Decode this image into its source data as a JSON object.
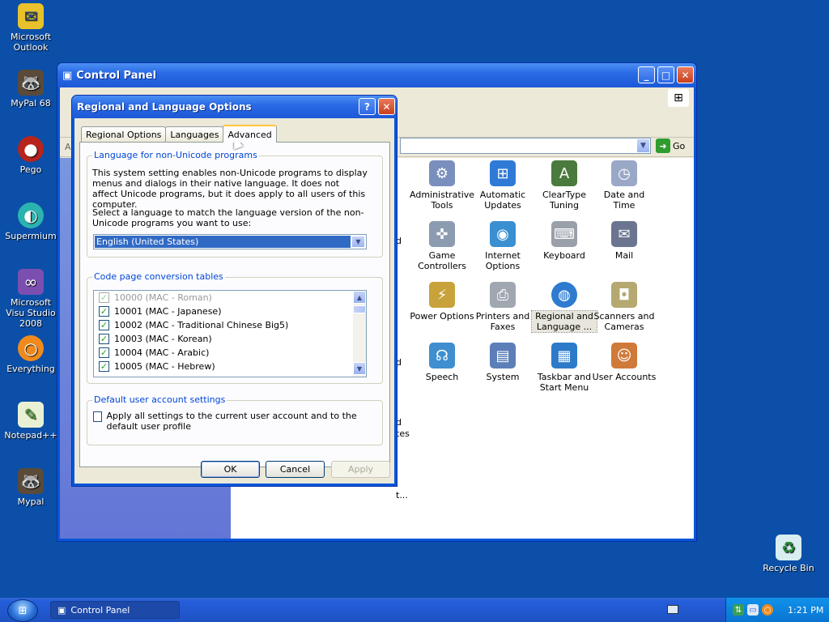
{
  "desktop": {
    "icons": [
      {
        "label": "Microsoft Outlook",
        "icon": "outlook-icon"
      },
      {
        "label": "MyPal 68",
        "icon": "mypal-icon"
      },
      {
        "label": "Pego",
        "icon": "pego-icon"
      },
      {
        "label": "Supermium",
        "icon": "supermium-icon"
      },
      {
        "label": "Microsoft Visu Studio 2008",
        "icon": "visual-studio-icon"
      },
      {
        "label": "Everything",
        "icon": "everything-icon"
      },
      {
        "label": "Notepad++",
        "icon": "notepad-plus-icon"
      },
      {
        "label": "Mypal",
        "icon": "mypal-icon"
      },
      {
        "label": "Recycle Bin",
        "icon": "recycle-bin-icon"
      }
    ]
  },
  "control_panel": {
    "title": "Control Panel",
    "go_label": "Go",
    "items": [
      {
        "label": "Administrative Tools",
        "color": "#7b8fbf"
      },
      {
        "label": "Automatic Updates",
        "color": "#2f7ad6"
      },
      {
        "label": "ClearType Tuning",
        "color": "#4a7a3c"
      },
      {
        "label": "Date and Time",
        "color": "#9aa8c8"
      },
      {
        "label": "Game Controllers",
        "color": "#8b9bb0"
      },
      {
        "label": "Internet Options",
        "color": "#3a8fd0"
      },
      {
        "label": "Keyboard",
        "color": "#9aa0aa"
      },
      {
        "label": "Mail",
        "color": "#6b7590"
      },
      {
        "label": "Power Options",
        "color": "#c8a23a"
      },
      {
        "label": "Printers and Faxes",
        "color": "#a0a7b0"
      },
      {
        "label": "Regional and Language ...",
        "color": "#2e7bcf"
      },
      {
        "label": "Scanners and Cameras",
        "color": "#b5a870"
      },
      {
        "label": "Speech",
        "color": "#3f8ecf"
      },
      {
        "label": "System",
        "color": "#5c7fb8"
      },
      {
        "label": "Taskbar and Start Menu",
        "color": "#2d7bc8"
      },
      {
        "label": "User Accounts",
        "color": "#d07a3a"
      }
    ],
    "partial_labels": [
      "d",
      "d",
      "d",
      "tes",
      "t..."
    ]
  },
  "dialog": {
    "title": "Regional and Language Options",
    "help_label": "?",
    "close_label": "✕",
    "tabs": [
      "Regional Options",
      "Languages",
      "Advanced"
    ],
    "non_unicode": {
      "legend": "Language for non-Unicode programs",
      "description": "This system setting enables non-Unicode programs to display menus and dialogs in their native language. It does not affect Unicode programs, but it does apply to all users of this computer.",
      "prompt": "Select a language to match the language version of the non-Unicode programs you want to use:",
      "selected_language": "English (United States)"
    },
    "code_page": {
      "legend": "Code page conversion tables",
      "rows": [
        {
          "label": "10000 (MAC - Roman)",
          "checked": true,
          "dim": true
        },
        {
          "label": "10001 (MAC - Japanese)",
          "checked": true,
          "dim": false
        },
        {
          "label": "10002 (MAC - Traditional Chinese Big5)",
          "checked": true,
          "dim": false
        },
        {
          "label": "10003 (MAC - Korean)",
          "checked": true,
          "dim": false
        },
        {
          "label": "10004 (MAC - Arabic)",
          "checked": true,
          "dim": false
        },
        {
          "label": "10005 (MAC - Hebrew)",
          "checked": true,
          "dim": false
        }
      ]
    },
    "default_user": {
      "legend": "Default user account settings",
      "checkbox_label": "Apply all settings to the current user account and to the default user profile"
    },
    "buttons": {
      "ok": "OK",
      "cancel": "Cancel",
      "apply": "Apply"
    }
  },
  "taskbar": {
    "task_label": "Control Panel",
    "clock": "1:21 PM"
  }
}
